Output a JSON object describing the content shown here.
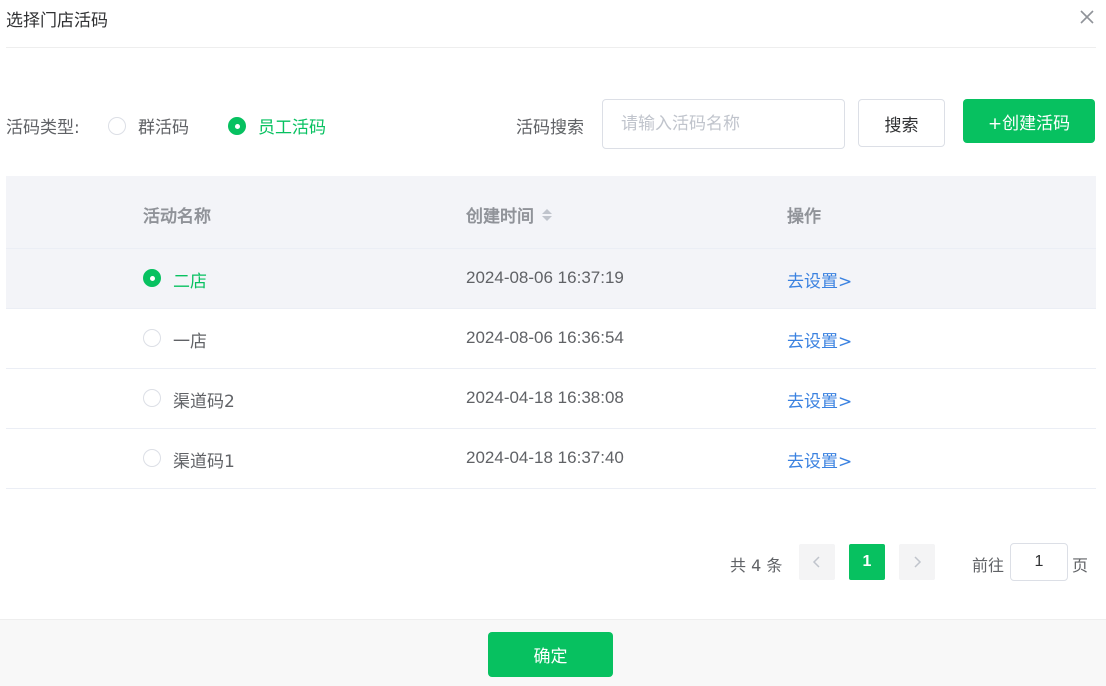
{
  "dialog": {
    "title": "选择门店活码",
    "close_icon": "close-icon"
  },
  "filter": {
    "type_label": "活码类型:",
    "types": [
      {
        "label": "群活码",
        "checked": false
      },
      {
        "label": "员工活码",
        "checked": true
      }
    ],
    "search_label": "活码搜索",
    "search_placeholder": "请输入活码名称",
    "search_value": "",
    "search_button": "搜索",
    "create_button": "+创建活码"
  },
  "table": {
    "columns": [
      "活动名称",
      "创建时间",
      "操作"
    ],
    "sort_icon": "sort-caret-icon",
    "rows": [
      {
        "name": "二店",
        "time": "2024-08-06 16:37:19",
        "action": "去设置>",
        "selected": true
      },
      {
        "name": "一店",
        "time": "2024-08-06 16:36:54",
        "action": "去设置>",
        "selected": false
      },
      {
        "name": "渠道码2",
        "time": "2024-04-18 16:38:08",
        "action": "去设置>",
        "selected": false
      },
      {
        "name": "渠道码1",
        "time": "2024-04-18 16:37:40",
        "action": "去设置>",
        "selected": false
      }
    ]
  },
  "pagination": {
    "total_text": "共 4 条",
    "current_page": "1",
    "goto_label": "前往",
    "goto_value": "1",
    "goto_suffix": "页"
  },
  "footer": {
    "confirm_button": "确定"
  },
  "colors": {
    "accent": "#07c160",
    "link": "#3b82e0",
    "header_bg": "#f3f4f8"
  }
}
